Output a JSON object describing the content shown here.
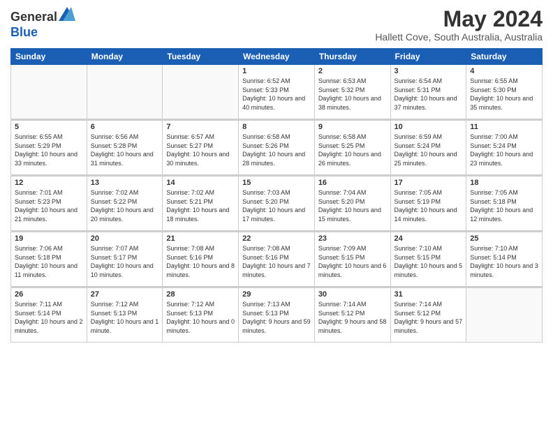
{
  "logo": {
    "general": "General",
    "blue": "Blue"
  },
  "header": {
    "month": "May 2024",
    "location": "Hallett Cove, South Australia, Australia"
  },
  "weekdays": [
    "Sunday",
    "Monday",
    "Tuesday",
    "Wednesday",
    "Thursday",
    "Friday",
    "Saturday"
  ],
  "weeks": [
    [
      {
        "day": "",
        "sunrise": "",
        "sunset": "",
        "daylight": ""
      },
      {
        "day": "",
        "sunrise": "",
        "sunset": "",
        "daylight": ""
      },
      {
        "day": "",
        "sunrise": "",
        "sunset": "",
        "daylight": ""
      },
      {
        "day": "1",
        "sunrise": "Sunrise: 6:52 AM",
        "sunset": "Sunset: 5:33 PM",
        "daylight": "Daylight: 10 hours and 40 minutes."
      },
      {
        "day": "2",
        "sunrise": "Sunrise: 6:53 AM",
        "sunset": "Sunset: 5:32 PM",
        "daylight": "Daylight: 10 hours and 38 minutes."
      },
      {
        "day": "3",
        "sunrise": "Sunrise: 6:54 AM",
        "sunset": "Sunset: 5:31 PM",
        "daylight": "Daylight: 10 hours and 37 minutes."
      },
      {
        "day": "4",
        "sunrise": "Sunrise: 6:55 AM",
        "sunset": "Sunset: 5:30 PM",
        "daylight": "Daylight: 10 hours and 35 minutes."
      }
    ],
    [
      {
        "day": "5",
        "sunrise": "Sunrise: 6:55 AM",
        "sunset": "Sunset: 5:29 PM",
        "daylight": "Daylight: 10 hours and 33 minutes."
      },
      {
        "day": "6",
        "sunrise": "Sunrise: 6:56 AM",
        "sunset": "Sunset: 5:28 PM",
        "daylight": "Daylight: 10 hours and 31 minutes."
      },
      {
        "day": "7",
        "sunrise": "Sunrise: 6:57 AM",
        "sunset": "Sunset: 5:27 PM",
        "daylight": "Daylight: 10 hours and 30 minutes."
      },
      {
        "day": "8",
        "sunrise": "Sunrise: 6:58 AM",
        "sunset": "Sunset: 5:26 PM",
        "daylight": "Daylight: 10 hours and 28 minutes."
      },
      {
        "day": "9",
        "sunrise": "Sunrise: 6:58 AM",
        "sunset": "Sunset: 5:25 PM",
        "daylight": "Daylight: 10 hours and 26 minutes."
      },
      {
        "day": "10",
        "sunrise": "Sunrise: 6:59 AM",
        "sunset": "Sunset: 5:24 PM",
        "daylight": "Daylight: 10 hours and 25 minutes."
      },
      {
        "day": "11",
        "sunrise": "Sunrise: 7:00 AM",
        "sunset": "Sunset: 5:24 PM",
        "daylight": "Daylight: 10 hours and 23 minutes."
      }
    ],
    [
      {
        "day": "12",
        "sunrise": "Sunrise: 7:01 AM",
        "sunset": "Sunset: 5:23 PM",
        "daylight": "Daylight: 10 hours and 21 minutes."
      },
      {
        "day": "13",
        "sunrise": "Sunrise: 7:02 AM",
        "sunset": "Sunset: 5:22 PM",
        "daylight": "Daylight: 10 hours and 20 minutes."
      },
      {
        "day": "14",
        "sunrise": "Sunrise: 7:02 AM",
        "sunset": "Sunset: 5:21 PM",
        "daylight": "Daylight: 10 hours and 18 minutes."
      },
      {
        "day": "15",
        "sunrise": "Sunrise: 7:03 AM",
        "sunset": "Sunset: 5:20 PM",
        "daylight": "Daylight: 10 hours and 17 minutes."
      },
      {
        "day": "16",
        "sunrise": "Sunrise: 7:04 AM",
        "sunset": "Sunset: 5:20 PM",
        "daylight": "Daylight: 10 hours and 15 minutes."
      },
      {
        "day": "17",
        "sunrise": "Sunrise: 7:05 AM",
        "sunset": "Sunset: 5:19 PM",
        "daylight": "Daylight: 10 hours and 14 minutes."
      },
      {
        "day": "18",
        "sunrise": "Sunrise: 7:05 AM",
        "sunset": "Sunset: 5:18 PM",
        "daylight": "Daylight: 10 hours and 12 minutes."
      }
    ],
    [
      {
        "day": "19",
        "sunrise": "Sunrise: 7:06 AM",
        "sunset": "Sunset: 5:18 PM",
        "daylight": "Daylight: 10 hours and 11 minutes."
      },
      {
        "day": "20",
        "sunrise": "Sunrise: 7:07 AM",
        "sunset": "Sunset: 5:17 PM",
        "daylight": "Daylight: 10 hours and 10 minutes."
      },
      {
        "day": "21",
        "sunrise": "Sunrise: 7:08 AM",
        "sunset": "Sunset: 5:16 PM",
        "daylight": "Daylight: 10 hours and 8 minutes."
      },
      {
        "day": "22",
        "sunrise": "Sunrise: 7:08 AM",
        "sunset": "Sunset: 5:16 PM",
        "daylight": "Daylight: 10 hours and 7 minutes."
      },
      {
        "day": "23",
        "sunrise": "Sunrise: 7:09 AM",
        "sunset": "Sunset: 5:15 PM",
        "daylight": "Daylight: 10 hours and 6 minutes."
      },
      {
        "day": "24",
        "sunrise": "Sunrise: 7:10 AM",
        "sunset": "Sunset: 5:15 PM",
        "daylight": "Daylight: 10 hours and 5 minutes."
      },
      {
        "day": "25",
        "sunrise": "Sunrise: 7:10 AM",
        "sunset": "Sunset: 5:14 PM",
        "daylight": "Daylight: 10 hours and 3 minutes."
      }
    ],
    [
      {
        "day": "26",
        "sunrise": "Sunrise: 7:11 AM",
        "sunset": "Sunset: 5:14 PM",
        "daylight": "Daylight: 10 hours and 2 minutes."
      },
      {
        "day": "27",
        "sunrise": "Sunrise: 7:12 AM",
        "sunset": "Sunset: 5:13 PM",
        "daylight": "Daylight: 10 hours and 1 minute."
      },
      {
        "day": "28",
        "sunrise": "Sunrise: 7:12 AM",
        "sunset": "Sunset: 5:13 PM",
        "daylight": "Daylight: 10 hours and 0 minutes."
      },
      {
        "day": "29",
        "sunrise": "Sunrise: 7:13 AM",
        "sunset": "Sunset: 5:13 PM",
        "daylight": "Daylight: 9 hours and 59 minutes."
      },
      {
        "day": "30",
        "sunrise": "Sunrise: 7:14 AM",
        "sunset": "Sunset: 5:12 PM",
        "daylight": "Daylight: 9 hours and 58 minutes."
      },
      {
        "day": "31",
        "sunrise": "Sunrise: 7:14 AM",
        "sunset": "Sunset: 5:12 PM",
        "daylight": "Daylight: 9 hours and 57 minutes."
      },
      {
        "day": "",
        "sunrise": "",
        "sunset": "",
        "daylight": ""
      }
    ]
  ]
}
